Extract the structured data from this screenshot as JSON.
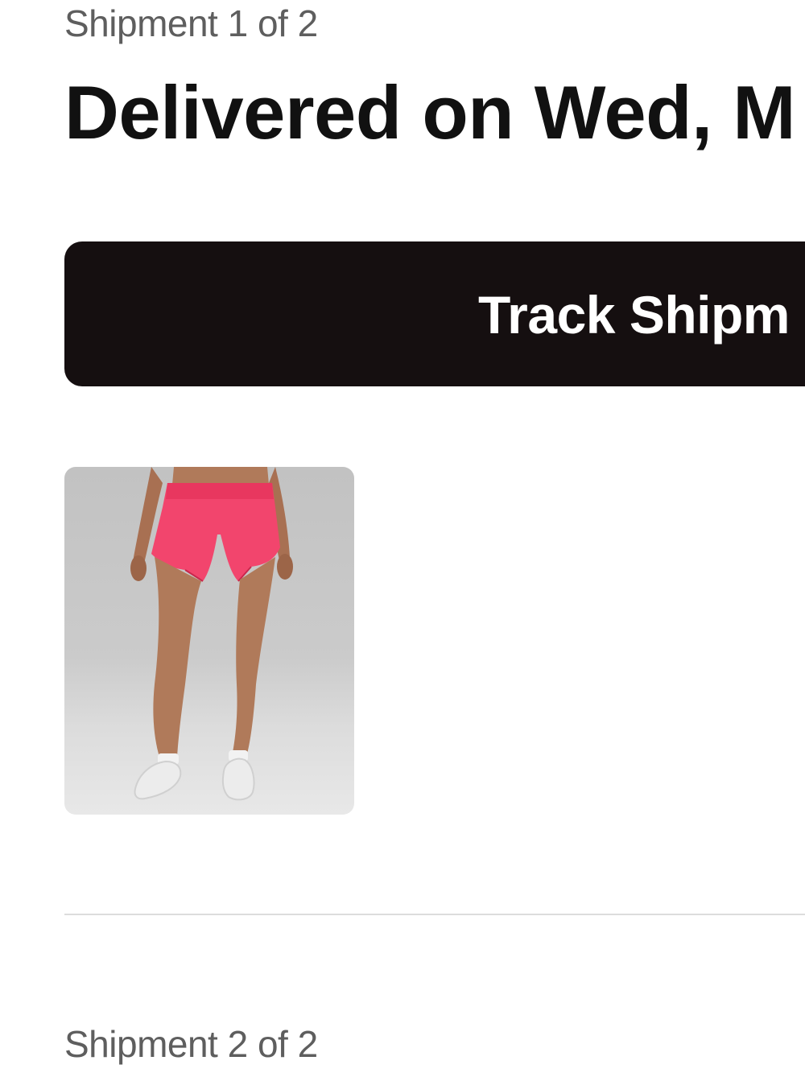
{
  "shipments": [
    {
      "label": "Shipment 1 of 2",
      "status": "Delivered on Wed, M",
      "track_button_label": "Track Shipm",
      "item": {
        "product_color": "#f2456d"
      }
    },
    {
      "label": "Shipment 2 of 2"
    }
  ],
  "colors": {
    "button_background": "#150f10",
    "button_text": "#ffffff",
    "label_text": "#5e5e5e",
    "heading_text": "#111111",
    "divider": "#dcdcdc"
  }
}
